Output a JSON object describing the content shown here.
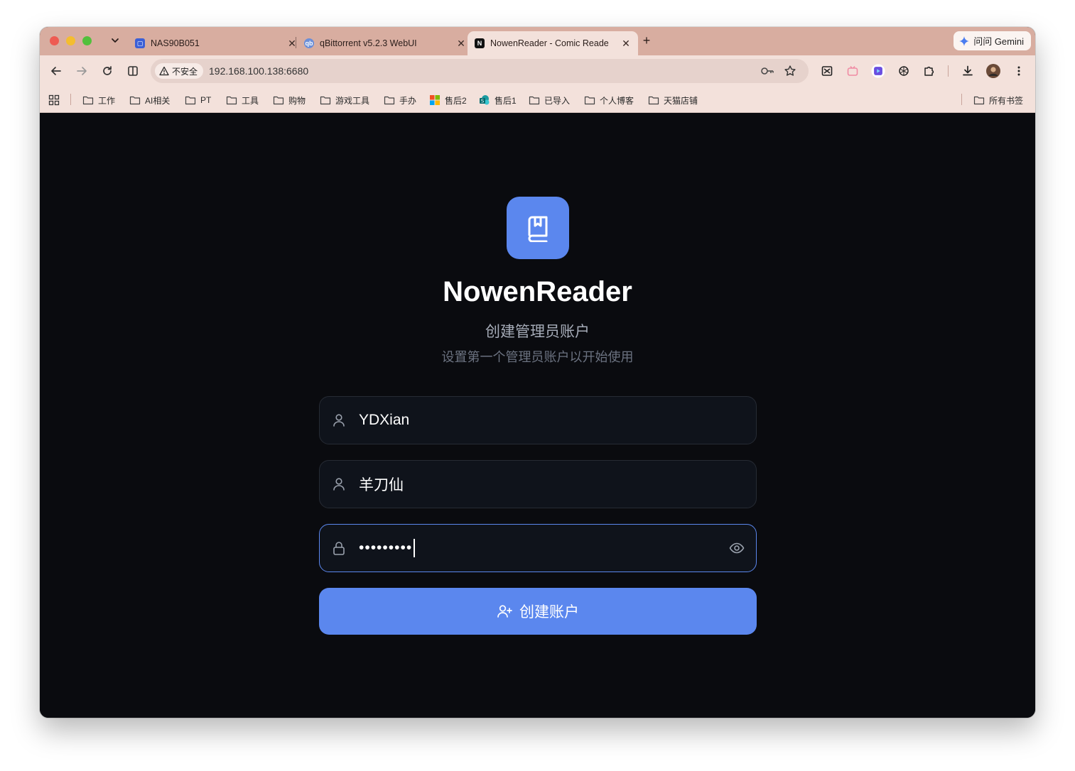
{
  "browser": {
    "tabs": [
      {
        "title": "NAS90B051",
        "favicon": "nas-icon",
        "favicon_color": "#3b5fd6"
      },
      {
        "title": "qBittorrent v5.2.3 WebUI",
        "favicon": "qbittorrent-icon",
        "favicon_color": "#6c8fd8"
      },
      {
        "title": "NowenReader - Comic Reade",
        "favicon": "nowen-icon",
        "favicon_color": "#111111",
        "active": true
      }
    ],
    "gemini_label": "问问 Gemini",
    "security_label": "不安全",
    "url": "192.168.100.138:6680",
    "bookmarks": [
      {
        "label": "工作",
        "icon": "folder-icon"
      },
      {
        "label": "AI相关",
        "icon": "folder-icon"
      },
      {
        "label": "PT",
        "icon": "folder-icon"
      },
      {
        "label": "工具",
        "icon": "folder-icon"
      },
      {
        "label": "购物",
        "icon": "folder-icon"
      },
      {
        "label": "游戏工具",
        "icon": "folder-icon"
      },
      {
        "label": "手办",
        "icon": "folder-icon"
      },
      {
        "label": "售后2",
        "icon": "microsoft-icon"
      },
      {
        "label": "售后1",
        "icon": "sharepoint-icon"
      },
      {
        "label": "已导入",
        "icon": "folder-icon"
      },
      {
        "label": "个人博客",
        "icon": "folder-icon"
      },
      {
        "label": "天猫店铺",
        "icon": "folder-icon"
      }
    ],
    "all_bookmarks_label": "所有书签"
  },
  "page": {
    "app_name": "NowenReader",
    "subtitle": "创建管理员账户",
    "description": "设置第一个管理员账户以开始使用",
    "username": {
      "value": "YDXian",
      "icon": "user-icon"
    },
    "nickname": {
      "value": "羊刀仙",
      "icon": "user-icon"
    },
    "password": {
      "value": "123456789",
      "icon": "lock-icon",
      "toggle_icon": "eye-icon"
    },
    "submit_label": "创建账户",
    "submit_icon": "user-plus-icon",
    "accent_color": "#5b87ee"
  }
}
